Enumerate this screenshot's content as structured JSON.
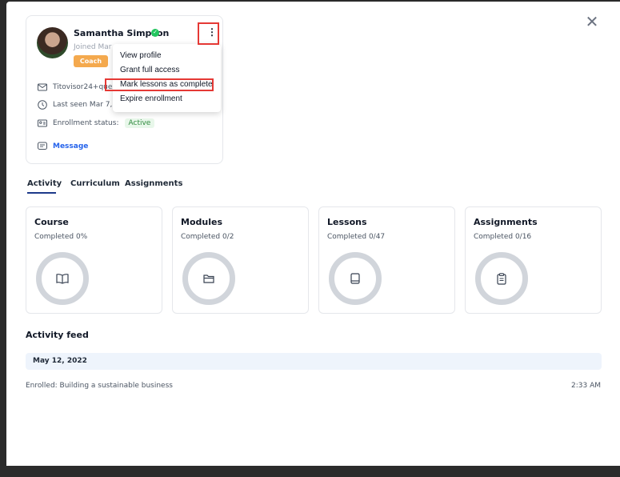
{
  "close_label": "✕",
  "profile": {
    "name": "Samantha Simpson",
    "joined": "Joined Mar",
    "role": "Coach",
    "email": "Titovisor24+ques",
    "last_seen": "Last seen Mar 7, 2",
    "enrollment_label": "Enrollment status:",
    "enrollment_status": "Active",
    "message_label": "Message",
    "menu_icon": "⋮"
  },
  "dropdown": {
    "items": [
      "View profile",
      "Grant full access",
      "Mark lessons as complete",
      "Expire enrollment"
    ]
  },
  "tabs": [
    "Activity",
    "Curriculum",
    "Assignments"
  ],
  "stats": [
    {
      "title": "Course",
      "sub": "Completed 0%",
      "icon": "book-open-icon"
    },
    {
      "title": "Modules",
      "sub": "Completed 0/2",
      "icon": "folders-icon"
    },
    {
      "title": "Lessons",
      "sub": "Completed 0/47",
      "icon": "book-icon"
    },
    {
      "title": "Assignments",
      "sub": "Completed 0/16",
      "icon": "clipboard-icon"
    }
  ],
  "feed": {
    "title": "Activity feed",
    "date": "May 12, 2022",
    "entry": "Enrolled: Building a sustainable business",
    "time": "2:33 AM"
  },
  "colors": {
    "accent": "#1e3a8a",
    "badge_orange": "#f4a94e",
    "status_green": "#2f8a3e",
    "highlight_red": "#e53935"
  }
}
